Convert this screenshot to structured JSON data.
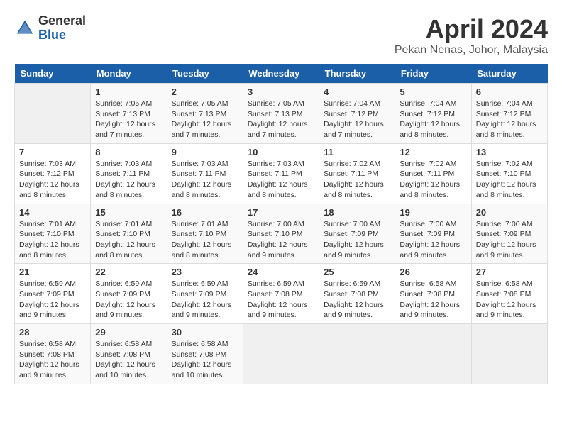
{
  "header": {
    "logo_general": "General",
    "logo_blue": "Blue",
    "title": "April 2024",
    "subtitle": "Pekan Nenas, Johor, Malaysia"
  },
  "calendar": {
    "days_of_week": [
      "Sunday",
      "Monday",
      "Tuesday",
      "Wednesday",
      "Thursday",
      "Friday",
      "Saturday"
    ],
    "weeks": [
      [
        {
          "day": "",
          "info": ""
        },
        {
          "day": "1",
          "info": "Sunrise: 7:05 AM\nSunset: 7:13 PM\nDaylight: 12 hours\nand 7 minutes."
        },
        {
          "day": "2",
          "info": "Sunrise: 7:05 AM\nSunset: 7:13 PM\nDaylight: 12 hours\nand 7 minutes."
        },
        {
          "day": "3",
          "info": "Sunrise: 7:05 AM\nSunset: 7:13 PM\nDaylight: 12 hours\nand 7 minutes."
        },
        {
          "day": "4",
          "info": "Sunrise: 7:04 AM\nSunset: 7:12 PM\nDaylight: 12 hours\nand 7 minutes."
        },
        {
          "day": "5",
          "info": "Sunrise: 7:04 AM\nSunset: 7:12 PM\nDaylight: 12 hours\nand 8 minutes."
        },
        {
          "day": "6",
          "info": "Sunrise: 7:04 AM\nSunset: 7:12 PM\nDaylight: 12 hours\nand 8 minutes."
        }
      ],
      [
        {
          "day": "7",
          "info": "Sunrise: 7:03 AM\nSunset: 7:12 PM\nDaylight: 12 hours\nand 8 minutes."
        },
        {
          "day": "8",
          "info": "Sunrise: 7:03 AM\nSunset: 7:11 PM\nDaylight: 12 hours\nand 8 minutes."
        },
        {
          "day": "9",
          "info": "Sunrise: 7:03 AM\nSunset: 7:11 PM\nDaylight: 12 hours\nand 8 minutes."
        },
        {
          "day": "10",
          "info": "Sunrise: 7:03 AM\nSunset: 7:11 PM\nDaylight: 12 hours\nand 8 minutes."
        },
        {
          "day": "11",
          "info": "Sunrise: 7:02 AM\nSunset: 7:11 PM\nDaylight: 12 hours\nand 8 minutes."
        },
        {
          "day": "12",
          "info": "Sunrise: 7:02 AM\nSunset: 7:11 PM\nDaylight: 12 hours\nand 8 minutes."
        },
        {
          "day": "13",
          "info": "Sunrise: 7:02 AM\nSunset: 7:10 PM\nDaylight: 12 hours\nand 8 minutes."
        }
      ],
      [
        {
          "day": "14",
          "info": "Sunrise: 7:01 AM\nSunset: 7:10 PM\nDaylight: 12 hours\nand 8 minutes."
        },
        {
          "day": "15",
          "info": "Sunrise: 7:01 AM\nSunset: 7:10 PM\nDaylight: 12 hours\nand 8 minutes."
        },
        {
          "day": "16",
          "info": "Sunrise: 7:01 AM\nSunset: 7:10 PM\nDaylight: 12 hours\nand 8 minutes."
        },
        {
          "day": "17",
          "info": "Sunrise: 7:00 AM\nSunset: 7:10 PM\nDaylight: 12 hours\nand 9 minutes."
        },
        {
          "day": "18",
          "info": "Sunrise: 7:00 AM\nSunset: 7:09 PM\nDaylight: 12 hours\nand 9 minutes."
        },
        {
          "day": "19",
          "info": "Sunrise: 7:00 AM\nSunset: 7:09 PM\nDaylight: 12 hours\nand 9 minutes."
        },
        {
          "day": "20",
          "info": "Sunrise: 7:00 AM\nSunset: 7:09 PM\nDaylight: 12 hours\nand 9 minutes."
        }
      ],
      [
        {
          "day": "21",
          "info": "Sunrise: 6:59 AM\nSunset: 7:09 PM\nDaylight: 12 hours\nand 9 minutes."
        },
        {
          "day": "22",
          "info": "Sunrise: 6:59 AM\nSunset: 7:09 PM\nDaylight: 12 hours\nand 9 minutes."
        },
        {
          "day": "23",
          "info": "Sunrise: 6:59 AM\nSunset: 7:09 PM\nDaylight: 12 hours\nand 9 minutes."
        },
        {
          "day": "24",
          "info": "Sunrise: 6:59 AM\nSunset: 7:08 PM\nDaylight: 12 hours\nand 9 minutes."
        },
        {
          "day": "25",
          "info": "Sunrise: 6:59 AM\nSunset: 7:08 PM\nDaylight: 12 hours\nand 9 minutes."
        },
        {
          "day": "26",
          "info": "Sunrise: 6:58 AM\nSunset: 7:08 PM\nDaylight: 12 hours\nand 9 minutes."
        },
        {
          "day": "27",
          "info": "Sunrise: 6:58 AM\nSunset: 7:08 PM\nDaylight: 12 hours\nand 9 minutes."
        }
      ],
      [
        {
          "day": "28",
          "info": "Sunrise: 6:58 AM\nSunset: 7:08 PM\nDaylight: 12 hours\nand 9 minutes."
        },
        {
          "day": "29",
          "info": "Sunrise: 6:58 AM\nSunset: 7:08 PM\nDaylight: 12 hours\nand 10 minutes."
        },
        {
          "day": "30",
          "info": "Sunrise: 6:58 AM\nSunset: 7:08 PM\nDaylight: 12 hours\nand 10 minutes."
        },
        {
          "day": "",
          "info": ""
        },
        {
          "day": "",
          "info": ""
        },
        {
          "day": "",
          "info": ""
        },
        {
          "day": "",
          "info": ""
        }
      ]
    ]
  }
}
